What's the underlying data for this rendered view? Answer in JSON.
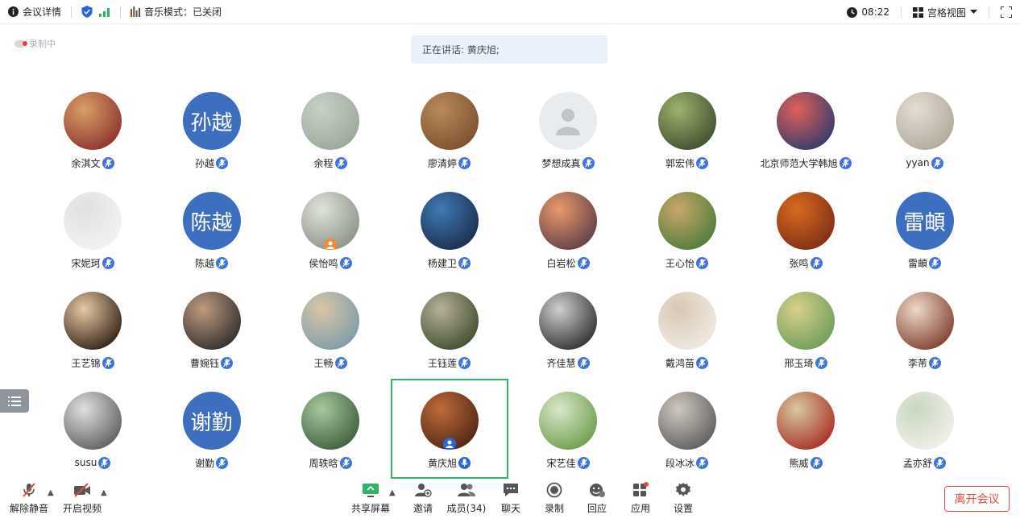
{
  "topbar": {
    "meeting_info": "会议详情",
    "music_mode": "音乐模式：已关闭",
    "time": "08:22",
    "view_mode": "宫格视图"
  },
  "recording": "录制中",
  "speaker_banner": "正在讲话: 黄庆旭;",
  "participants": [
    {
      "name": "余淇文",
      "avatar": "photo"
    },
    {
      "name": "孙越",
      "avatar": "text",
      "avatar_text": "孙越"
    },
    {
      "name": "余程",
      "avatar": "photo"
    },
    {
      "name": "廖清婷",
      "avatar": "photo"
    },
    {
      "name": "梦想成真",
      "avatar": "default"
    },
    {
      "name": "郭宏伟",
      "avatar": "photo"
    },
    {
      "name": "北京师范大学韩旭",
      "avatar": "photo"
    },
    {
      "name": "yyan",
      "avatar": "photo"
    },
    {
      "name": "宋妮珂",
      "avatar": "photo"
    },
    {
      "name": "陈越",
      "avatar": "text",
      "avatar_text": "陈越"
    },
    {
      "name": "侯怡鸣",
      "avatar": "photo"
    },
    {
      "name": "杨建卫",
      "avatar": "photo"
    },
    {
      "name": "白岩松",
      "avatar": "photo"
    },
    {
      "name": "王心怡",
      "avatar": "photo"
    },
    {
      "name": "张鸣",
      "avatar": "photo"
    },
    {
      "name": "雷頔",
      "avatar": "text",
      "avatar_text": "雷頔"
    },
    {
      "name": "王艺锦",
      "avatar": "photo"
    },
    {
      "name": "曹婉钰",
      "avatar": "photo"
    },
    {
      "name": "王畅",
      "avatar": "photo"
    },
    {
      "name": "王钰莲",
      "avatar": "photo"
    },
    {
      "name": "齐佳慧",
      "avatar": "photo"
    },
    {
      "name": "戴鸿苗",
      "avatar": "photo"
    },
    {
      "name": "邢玉琦",
      "avatar": "photo"
    },
    {
      "name": "李芾",
      "avatar": "photo"
    },
    {
      "name": "susu",
      "avatar": "photo"
    },
    {
      "name": "谢勤",
      "avatar": "text",
      "avatar_text": "谢勤"
    },
    {
      "name": "周轶晗",
      "avatar": "photo"
    },
    {
      "name": "黄庆旭",
      "avatar": "photo",
      "speaking": true
    },
    {
      "name": "宋艺佳",
      "avatar": "photo"
    },
    {
      "name": "段冰冰",
      "avatar": "photo"
    },
    {
      "name": "熊威",
      "avatar": "photo"
    },
    {
      "name": "孟亦舒",
      "avatar": "photo"
    }
  ],
  "toolbar": {
    "unmute": "解除静音",
    "start_video": "开启视频",
    "share_screen": "共享屏幕",
    "invite": "邀请",
    "members": "成员(34)",
    "chat": "聊天",
    "record": "录制",
    "playback": "回应",
    "apps": "应用",
    "settings": "设置",
    "leave": "离开会议"
  },
  "colors": {
    "accent_blue": "#3e6ec0",
    "active_border": "#2fb463",
    "leave_red": "#e8483d",
    "banner_bg": "#eaf1fb"
  }
}
